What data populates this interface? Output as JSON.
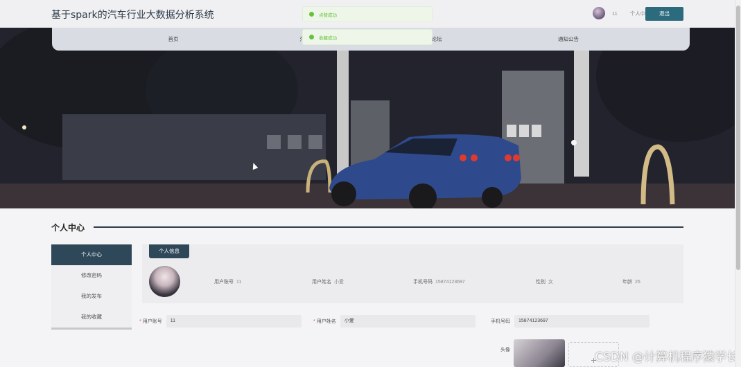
{
  "header": {
    "site_title": "基于spark的汽车行业大数据分析系统",
    "user_count": "11",
    "user_center": "个人中心",
    "logout": "退出"
  },
  "nav": {
    "items": [
      "首页",
      "汽车",
      "论坛",
      "通知公告"
    ]
  },
  "toasts": [
    "点赞成功",
    "收藏成功"
  ],
  "section": {
    "title": "个人中心"
  },
  "sidebar": {
    "items": [
      "个人中心",
      "修改密码",
      "我的发布",
      "我的收藏"
    ],
    "active_index": 0
  },
  "profile_card": {
    "tag": "个人信息",
    "fields": [
      {
        "label": "用户账号",
        "value": "11"
      },
      {
        "label": "用户姓名",
        "value": "小爱"
      },
      {
        "label": "手机号码",
        "value": "15874123697"
      },
      {
        "label": "性别",
        "value": "女"
      },
      {
        "label": "年龄",
        "value": "25"
      }
    ]
  },
  "form": {
    "account_label": "用户账号",
    "account_value": "11",
    "name_label": "用户姓名",
    "name_value": "小爱",
    "phone_label": "手机号码",
    "phone_value": "15874123697",
    "avatar_label": "头像",
    "upload_symbol": "+"
  },
  "watermark": "CSDN @计算机程序猿学长",
  "colors": {
    "accent": "#2c6b7d",
    "sidebar_active": "#2e4759",
    "toast_green": "#67c23a"
  }
}
